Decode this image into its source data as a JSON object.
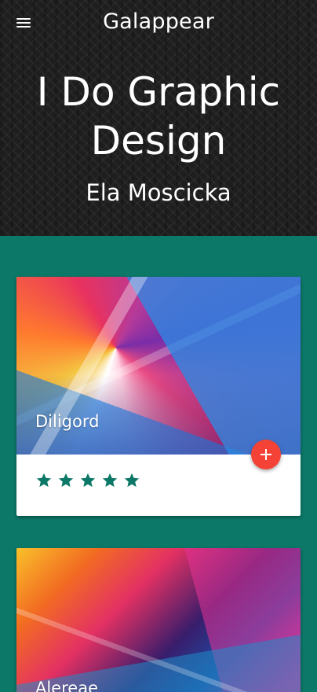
{
  "header": {
    "menu_icon": "hamburger-menu-icon",
    "app_title": "Galappear",
    "hero_title_line1": "I Do Graphic",
    "hero_title_line2": "Design",
    "hero_subtitle": "Ela Moscicka"
  },
  "cards": [
    {
      "caption": "Diligord",
      "rating": 5,
      "action_icon": "plus-icon"
    },
    {
      "caption": "Alereae"
    }
  ],
  "colors": {
    "accent": "#0c7868",
    "fab": "#f44336",
    "header_bg": "#1e1e1e",
    "star": "#0c7868"
  }
}
